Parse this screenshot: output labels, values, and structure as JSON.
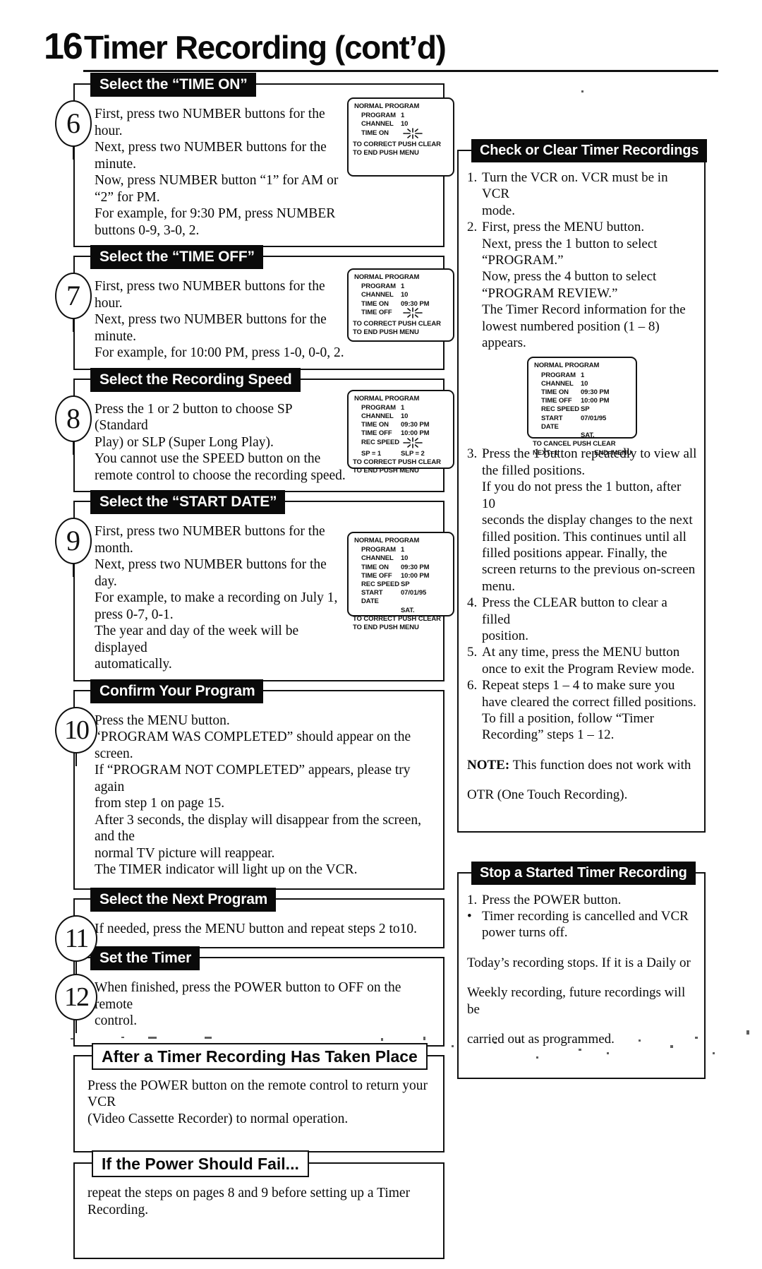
{
  "page": {
    "number": "16",
    "title": "Timer Recording (cont’d)"
  },
  "left_column": {
    "steps": [
      {
        "number": "6",
        "title": "Select the “TIME ON”",
        "lines": [
          "First, press two NUMBER buttons for the hour.",
          "Next, press two NUMBER buttons for the",
          "minute.",
          "Now, press NUMBER button “1” for AM or",
          "“2” for PM.",
          "For example, for 9:30 PM, press NUMBER buttons 0-9, 3-0, 2."
        ],
        "osd": {
          "head": "NORMAL PROGRAM",
          "rows": [
            {
              "label": "PROGRAM",
              "value": "1"
            },
            {
              "label": "CHANNEL",
              "value": "10"
            },
            {
              "label": "TIME ON",
              "value": "",
              "blink": true
            }
          ],
          "foot_lines": [
            "TO CORRECT PUSH CLEAR",
            "TO END PUSH MENU"
          ]
        }
      },
      {
        "number": "7",
        "title": "Select the “TIME OFF”",
        "lines": [
          "First, press two NUMBER buttons for the hour.",
          "Next, press two NUMBER buttons for the",
          "minute.",
          "For example, for 10:00 PM, press 1-0, 0-0, 2."
        ],
        "osd": {
          "head": "NORMAL PROGRAM",
          "rows": [
            {
              "label": "PROGRAM",
              "value": "1"
            },
            {
              "label": "CHANNEL",
              "value": "10"
            },
            {
              "label": "TIME ON",
              "value": "09:30 PM"
            },
            {
              "label": "TIME OFF",
              "value": "",
              "blink": true
            }
          ],
          "foot_lines": [
            "TO CORRECT PUSH CLEAR",
            "TO END PUSH MENU"
          ]
        }
      },
      {
        "number": "8",
        "title": "Select the Recording Speed",
        "lines": [
          "Press the 1 or 2 button to choose SP (Standard",
          "Play) or SLP (Super Long Play).",
          "You cannot use the SPEED button on the",
          "remote control to choose the recording speed."
        ],
        "osd": {
          "head": "NORMAL PROGRAM",
          "rows": [
            {
              "label": "PROGRAM",
              "value": "1"
            },
            {
              "label": "CHANNEL",
              "value": "10"
            },
            {
              "label": "TIME ON",
              "value": "09:30 PM"
            },
            {
              "label": "TIME OFF",
              "value": "10:00 PM"
            },
            {
              "label": "REC SPEED",
              "value": "",
              "blink": true
            },
            {
              "label": "SP = 1",
              "value": "SLP = 2",
              "legend": true
            }
          ],
          "foot_lines": [
            "TO CORRECT PUSH CLEAR",
            "TO END PUSH MENU"
          ]
        }
      },
      {
        "number": "9",
        "title": "Select the “START DATE”",
        "lines": [
          "First, press two NUMBER buttons for the month.",
          "Next, press two NUMBER buttons for the day.",
          "For example, to make a recording on July 1,",
          "press 0-7, 0-1.",
          "The year and day of the week will be displayed",
          "automatically."
        ],
        "osd": {
          "head": "NORMAL PROGRAM",
          "rows": [
            {
              "label": "PROGRAM",
              "value": "1"
            },
            {
              "label": "CHANNEL",
              "value": "10"
            },
            {
              "label": "TIME ON",
              "value": "09:30 PM"
            },
            {
              "label": "TIME OFF",
              "value": "10:00 PM"
            },
            {
              "label": "REC SPEED",
              "value": "SP"
            },
            {
              "label": "START DATE",
              "value": "07/01/95"
            },
            {
              "label": "",
              "value": "SAT."
            }
          ],
          "foot_lines": [
            "TO CORRECT PUSH CLEAR",
            "TO END PUSH MENU"
          ]
        }
      },
      {
        "number": "10",
        "title": "Confirm Your Program",
        "lines": [
          "Press the MENU button.",
          "“PROGRAM WAS COMPLETED” should appear on the screen.",
          "If “PROGRAM NOT COMPLETED” appears, please try again",
          "from step 1 on page 15.",
          "After 3 seconds, the display will disappear from the screen, and the",
          "normal TV picture will reappear.",
          "The TIMER indicator will light up on the VCR."
        ]
      },
      {
        "number": "11",
        "title": "Select the Next Program",
        "lines": [
          "If needed, press the MENU button and repeat steps 2 to10."
        ]
      },
      {
        "number": "12",
        "title": "Set the Timer",
        "lines": [
          "When finished, press the POWER button to OFF on the remote",
          "control."
        ]
      }
    ],
    "plain_sections": [
      {
        "title": "After a Timer Recording Has Taken Place",
        "lines": [
          "Press the POWER button on the remote control to return your VCR",
          "(Video Cassette Recorder) to normal operation."
        ]
      },
      {
        "title": "If the Power Should Fail...",
        "lines": [
          "repeat the steps on pages 8 and 9 before setting up a Timer",
          "Recording."
        ]
      }
    ]
  },
  "right_column": {
    "check_clear": {
      "title": "Check or Clear Timer Recordings",
      "items_before_osd": [
        {
          "number": "1.",
          "lines": [
            "Turn the VCR on. VCR must be in VCR",
            "mode."
          ]
        },
        {
          "number": "2.",
          "lines": [
            "First, press the MENU button.",
            "Next, press the 1 button to select",
            "“PROGRAM.”",
            "Now, press the 4 button to select",
            "“PROGRAM REVIEW.”",
            "The Timer Record information for the",
            "lowest numbered position (1 – 8)",
            "appears."
          ]
        }
      ],
      "osd": {
        "head": "NORMAL PROGRAM",
        "rows": [
          {
            "label": "PROGRAM",
            "value": "1"
          },
          {
            "label": "CHANNEL",
            "value": "10"
          },
          {
            "label": "TIME ON",
            "value": "09:30 PM"
          },
          {
            "label": "TIME OFF",
            "value": "10:00 PM"
          },
          {
            "label": "REC SPEED",
            "value": "SP"
          },
          {
            "label": "START DATE",
            "value": "07/01/95"
          },
          {
            "label": "",
            "value": "SAT."
          }
        ],
        "foot_lines": [
          "TO CANCEL PUSH CLEAR"
        ],
        "foot_row2": {
          "left": "NEXT=1",
          "right": "END=MENU"
        }
      },
      "items_after_osd": [
        {
          "number": "3.",
          "lines": [
            "Press the 1 button repeatedly to view all",
            "the filled positions.",
            "If you do not press the 1 button, after 10",
            "seconds the display changes to the next",
            "filled position. This continues until all",
            "filled positions appear. Finally, the",
            "screen returns to the previous on-screen",
            "menu."
          ]
        },
        {
          "number": "4.",
          "lines": [
            "Press the CLEAR button to clear a filled",
            "position."
          ]
        },
        {
          "number": "5.",
          "lines": [
            "At any time, press the MENU button",
            "once to exit the Program Review mode."
          ]
        },
        {
          "number": "6.",
          "lines": [
            "Repeat steps 1 – 4 to make sure you",
            "have cleared the correct filled positions.",
            "To fill a position, follow “Timer",
            "Recording” steps 1 – 12."
          ]
        }
      ],
      "note_label": "NOTE:",
      "note_lines": [
        " This function does not work with",
        "OTR (One Touch Recording)."
      ]
    },
    "stop_recording": {
      "title": "Stop a Started Timer Recording",
      "items": [
        {
          "number": "1.",
          "lines": [
            "Press the POWER button."
          ]
        },
        {
          "number": "•",
          "lines": [
            "Timer recording is cancelled and VCR",
            "power turns off."
          ]
        }
      ],
      "tail_lines": [
        "Today’s recording stops. If it is a Daily or",
        "Weekly recording, future recordings will be",
        "carried out as programmed."
      ]
    }
  }
}
